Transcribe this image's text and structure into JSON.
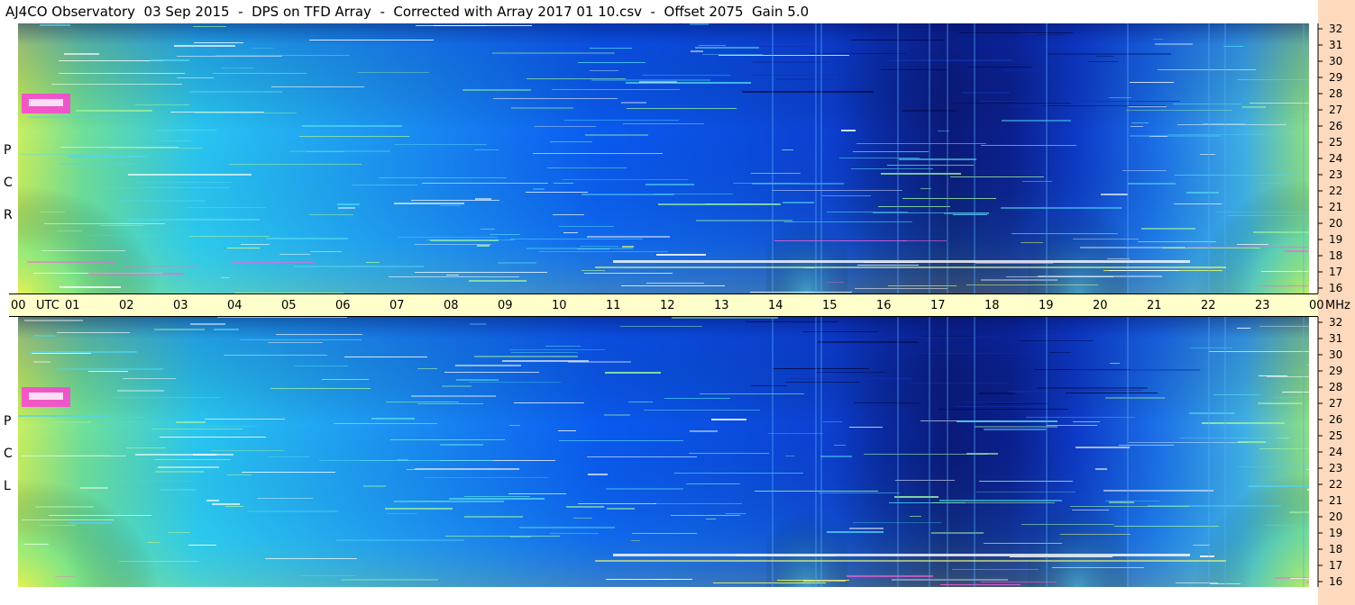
{
  "title": "AJ4CO Observatory  03 Sep 2015  -  DPS on TFD Array  -  Corrected with Array 2017 01 10.csv  -  Offset 2075  Gain 5.0",
  "panels": [
    {
      "label_letters": [
        "R",
        "C",
        "P"
      ]
    },
    {
      "label_letters": [
        "L",
        "C",
        "P"
      ]
    }
  ],
  "time_axis": {
    "labels": [
      "00",
      "01",
      "02",
      "03",
      "04",
      "05",
      "06",
      "07",
      "08",
      "09",
      "10",
      "11",
      "12",
      "13",
      "14",
      "15",
      "16",
      "17",
      "18",
      "19",
      "20",
      "21",
      "22",
      "23",
      "00"
    ],
    "unit_left": "UTC",
    "unit_right": "MHz"
  },
  "colors": {
    "title_bg": "#ffffff",
    "axis_bg": "#ffffcc",
    "right_bg": "#fdd9bd",
    "spectro_deep": "#0a1a7a",
    "spectro_mid": "#0a5af0",
    "spectro_light": "#29c6f2",
    "spectro_warm": "#c8f060",
    "spectro_hot": "#ff3fd6"
  },
  "chart_data": {
    "type": "heatmap",
    "x_axis": {
      "label": "UTC",
      "range": [
        "00",
        "00"
      ],
      "tick_labels": [
        "00",
        "01",
        "02",
        "03",
        "04",
        "05",
        "06",
        "07",
        "08",
        "09",
        "10",
        "11",
        "12",
        "13",
        "14",
        "15",
        "16",
        "17",
        "18",
        "19",
        "20",
        "21",
        "22",
        "23",
        "00"
      ]
    },
    "y_axis": {
      "label": "MHz",
      "range": [
        16,
        32
      ],
      "tick_labels": [
        16,
        17,
        18,
        19,
        20,
        21,
        22,
        23,
        24,
        25,
        26,
        27,
        28,
        29,
        30,
        31,
        32
      ]
    },
    "series": [
      {
        "name": "RCP"
      },
      {
        "name": "LCP"
      }
    ],
    "offset": 2075,
    "gain": 5.0
  }
}
